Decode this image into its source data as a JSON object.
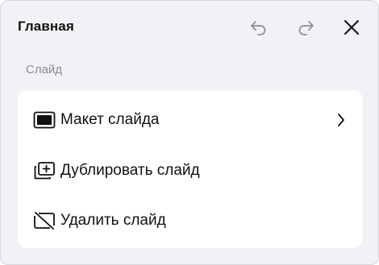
{
  "header": {
    "title": "Главная",
    "icons": [
      "undo-icon",
      "redo-icon",
      "close-icon"
    ]
  },
  "section": {
    "label": "Слайд"
  },
  "menu": {
    "items": [
      {
        "label": "Макет слайда",
        "icon": "slide-layout-icon",
        "has_submenu": true
      },
      {
        "label": "Дублировать слайд",
        "icon": "duplicate-slide-icon",
        "has_submenu": false
      },
      {
        "label": "Удалить слайд",
        "icon": "delete-slide-icon",
        "has_submenu": false
      }
    ]
  },
  "colors": {
    "panel_background": "#f2f2f6",
    "card_background": "#ffffff",
    "text": "#111111",
    "muted_text": "#8a8a90",
    "disabled_icon": "#8e8e93"
  }
}
